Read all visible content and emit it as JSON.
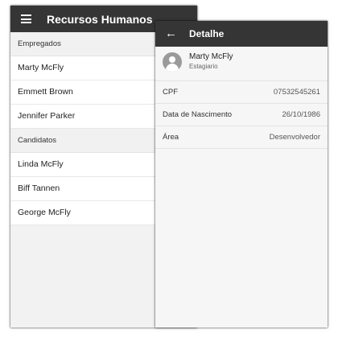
{
  "list_screen": {
    "title": "Recursos Humanos",
    "sections": [
      {
        "header": "Empregados",
        "items": [
          "Marty McFly",
          "Emmett Brown",
          "Jennifer Parker"
        ]
      },
      {
        "header": "Candidatos",
        "items": [
          "Linda McFly",
          "Biff Tannen",
          "George McFly"
        ]
      }
    ]
  },
  "detail_screen": {
    "title": "Detalhe",
    "profile": {
      "name": "Marty McFly",
      "role": "Estagiario"
    },
    "fields": [
      {
        "label": "CPF",
        "value": "07532545261"
      },
      {
        "label": "Data de Nascimento",
        "value": "26/10/1986"
      },
      {
        "label": "Área",
        "value": "Desenvolvedor"
      }
    ]
  }
}
